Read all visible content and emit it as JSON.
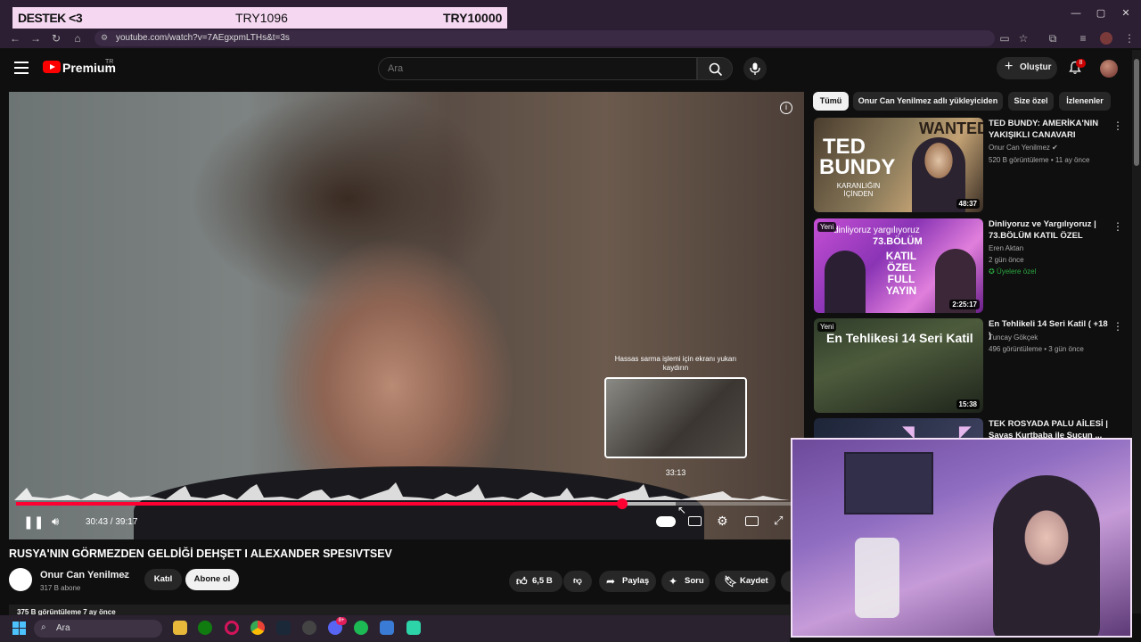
{
  "browser": {
    "url": "youtube.com/watch?v=7AEgxpmLTHs&t=3s"
  },
  "banner": {
    "left": "DESTEK <3",
    "middle": "TRY1096",
    "right": "TRY10000"
  },
  "header": {
    "brand": "Premium",
    "region": "TR",
    "search_placeholder": "Ara",
    "create_label": "Oluştur",
    "notification_count": "8"
  },
  "player": {
    "seek_hint": "Hassas sarma işlemi için ekranı yukarı kaydırın",
    "preview_time": "33:13",
    "time_display": "30:43 / 39:17",
    "progress_fraction": 0.782,
    "buffer_fraction": 0.85
  },
  "video": {
    "title": "RUSYA'NIN GÖRMEZDEN GELDİĞİ DEHŞET I ALEXANDER SPESIVTSEV",
    "channel": "Onur Can Yenilmez",
    "subscribers": "317 B abone",
    "join_label": "Katıl",
    "subscribe_label": "Abone ol",
    "like_count": "6,5 B",
    "share_label": "Paylaş",
    "ask_label": "Soru",
    "save_label": "Kaydet",
    "views_line": "375 B görüntüleme  7 ay önce"
  },
  "chips": [
    "Tümü",
    "Onur Can Yenilmez adlı yükleyiciden",
    "Size özel",
    "İzlenenler"
  ],
  "recommendations": [
    {
      "title": "TED BUNDY: AMERİKA'NIN YAKIŞIKLI CANAVARI",
      "channel": "Onur Can Yenilmez",
      "meta": "520 B görüntüleme • 11 ay önce",
      "duration": "48:37",
      "thumb_text_1": "TED",
      "thumb_text_2": "BUNDY",
      "thumb_text_3": "KARANLIĞIN İÇİNDEN",
      "thumb_text_4": "WANTED"
    },
    {
      "title": "Dinliyoruz ve Yargılıyoruz | 73.BÖLÜM KATIL ÖZEL",
      "channel": "Eren Aktan",
      "meta": "2 gün önce",
      "badge": "Üyelere özel",
      "duration": "2:25:17",
      "new_label": "Yeni",
      "thumb_text_1": "dinliyoruz   yargılıyoruz",
      "thumb_text_2": "73.BÖLÜM",
      "thumb_text_3": "KATIL ÖZEL FULL YAYIN"
    },
    {
      "title": "En Tehlikeli 14 Seri Katil ( +18 )",
      "channel": "Tuncay Gökçek",
      "meta": "496 görüntüleme • 3 gün önce",
      "duration": "15:38",
      "new_label": "Yeni",
      "thumb_text_1": "En Tehlikesi 14 Seri Katil"
    },
    {
      "title": "TEK ROSYADA PALU AİLESİ | Savaş Kurtbaba ile Suçun ..."
    }
  ],
  "taskbar": {
    "search_label": "Ara",
    "discord_badge": "8+"
  },
  "colors": {
    "accent_red": "#ff0033",
    "banner_bg": "#f5d7f2",
    "webcam_border": "#f2e0f7"
  }
}
